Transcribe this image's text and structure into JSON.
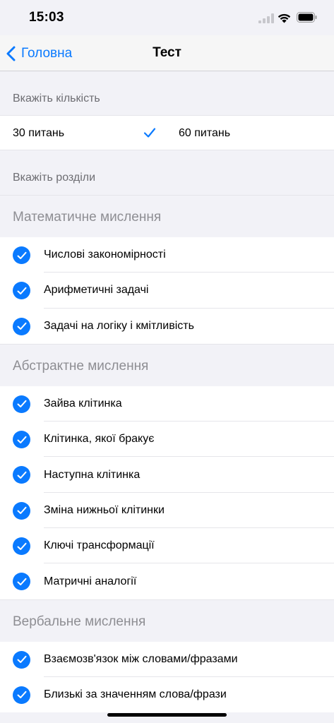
{
  "status": {
    "time": "15:03"
  },
  "nav": {
    "back_label": "Головна",
    "title": "Тест"
  },
  "count_section": {
    "header": "Вкажіть кількість",
    "options": [
      "30 питань",
      "60 питань"
    ],
    "selected_index": 0
  },
  "sections_header": "Вкажіть розділи",
  "groups": [
    {
      "title": "Математичне мислення",
      "items": [
        "Числові закономірності",
        "Арифметичні задачі",
        "Задачі на логіку і кмітливість"
      ]
    },
    {
      "title": "Абстрактне мислення",
      "items": [
        "Зайва клітинка",
        "Клітинка, якої бракує",
        "Наступна клітинка",
        "Зміна нижньої клітинки",
        "Ключі трансформації",
        "Матричні аналогії"
      ]
    },
    {
      "title": "Вербальне мислення",
      "items": [
        "Взаємозв'язок між словами/фразами",
        "Близькі за значенням слова/фрази"
      ]
    }
  ],
  "colors": {
    "accent": "#0a7aff",
    "background": "#f2f2f7",
    "secondary_text": "#8e8e93"
  },
  "icons": {
    "check": "checkmark-icon",
    "back": "chevron-left-icon"
  }
}
